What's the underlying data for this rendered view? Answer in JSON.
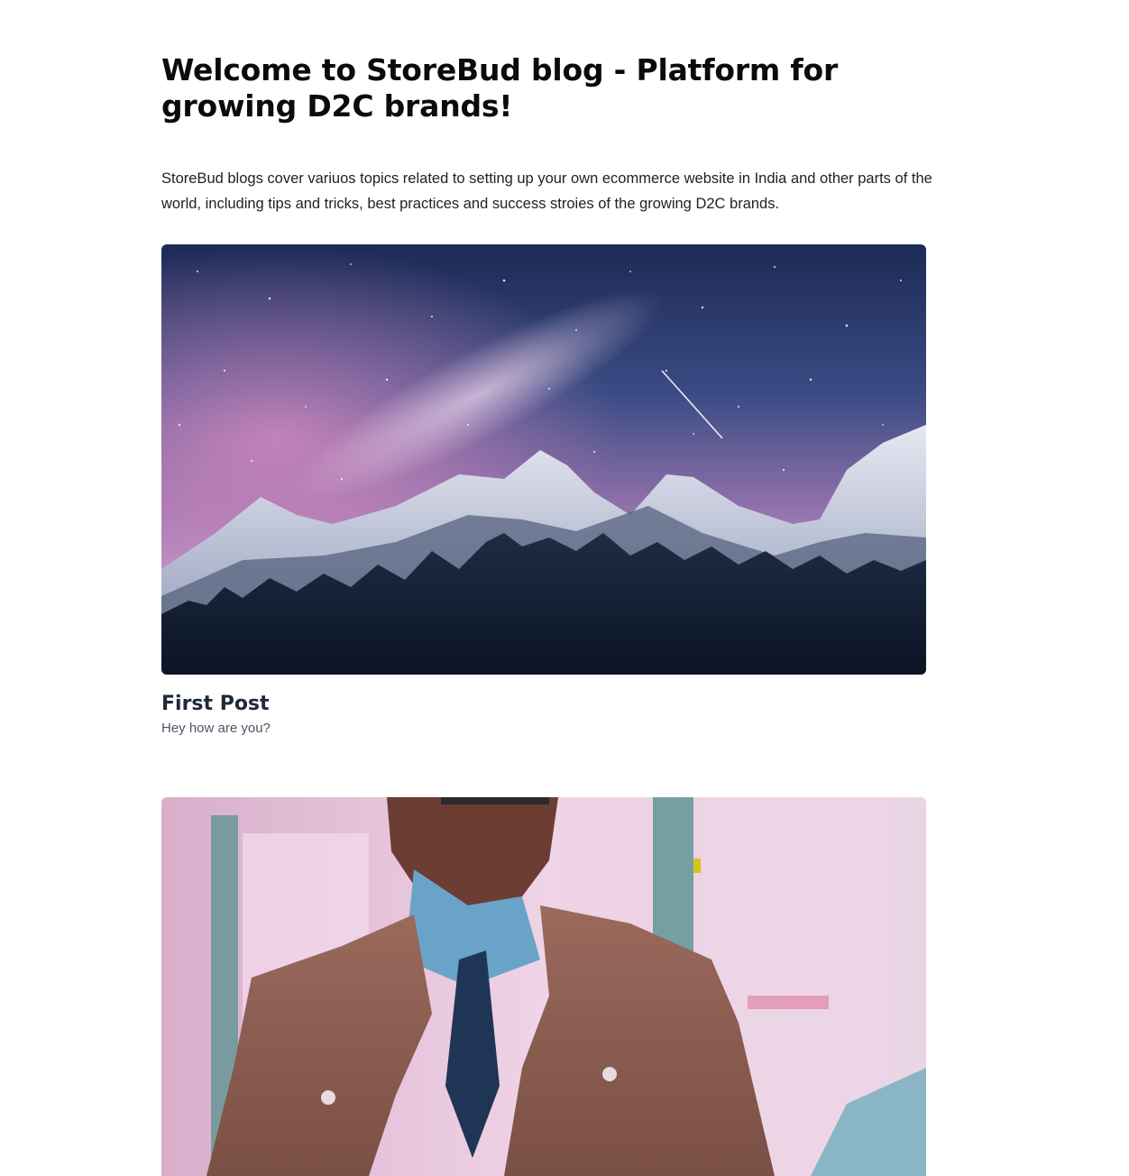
{
  "header": {
    "title": "Welcome to StoreBud blog - Platform for growing D2C brands!",
    "intro": "StoreBud blogs cover variuos topics related to setting up your own ecommerce website in India and other parts of the world, including tips and tricks, best practices and success stroies of the growing D2C brands."
  },
  "posts": [
    {
      "title": "First Post",
      "description": "Hey how are you?",
      "image_subject": "night sky milky way over snowy mountains"
    },
    {
      "image_subject": "man in brown leather jacket and blue shirt with tie"
    }
  ],
  "colors": {
    "title": "#0b0b0b",
    "body_text": "#222222",
    "post_title": "#1f2937",
    "post_desc": "#4b5563"
  }
}
